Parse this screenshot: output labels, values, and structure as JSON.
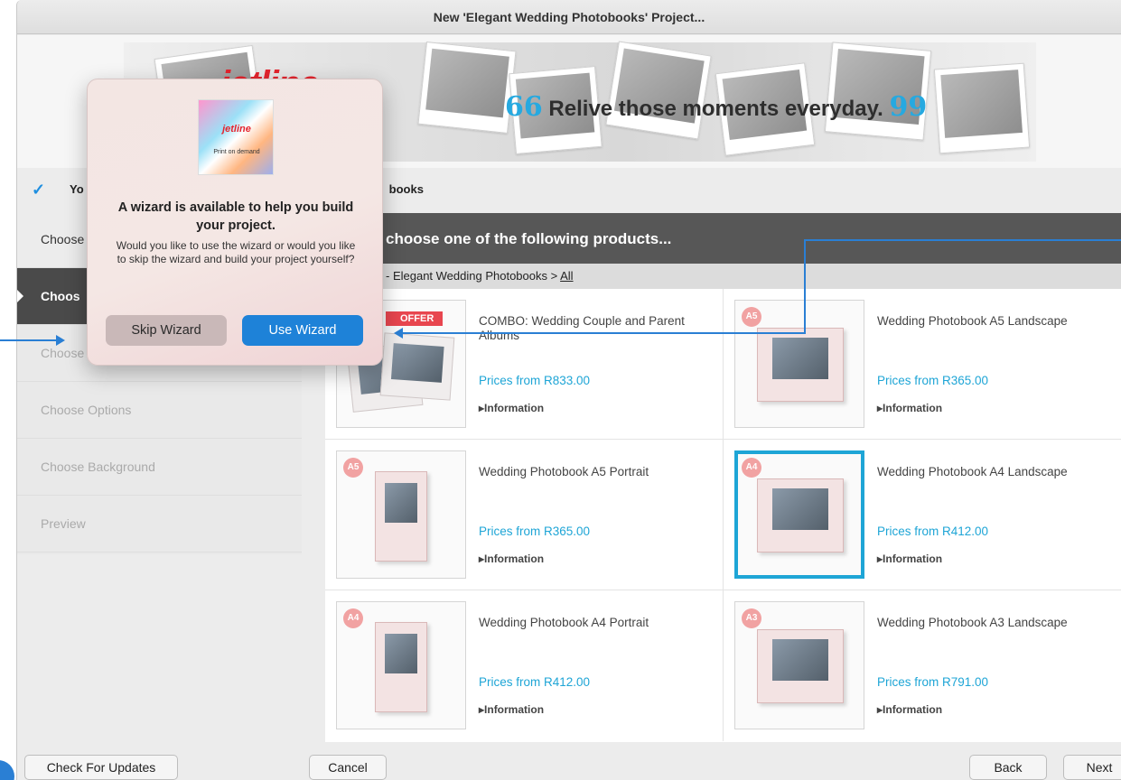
{
  "window": {
    "title": "New 'Elegant Wedding Photobooks' Project..."
  },
  "banner": {
    "logo_text": "jetline",
    "tagline": "Relive those moments everyday.",
    "quote_open": "66",
    "quote_close": "99"
  },
  "step": {
    "title_start": "Yo",
    "title_end": "books"
  },
  "sidebar": {
    "items": [
      {
        "label": "Choose"
      },
      {
        "label": "Choos"
      },
      {
        "label": "Choose"
      },
      {
        "label": "Choose Options"
      },
      {
        "label": "Choose Background"
      },
      {
        "label": "Preview"
      }
    ]
  },
  "main": {
    "header": "choose one of the following products...",
    "breadcrumb": {
      "prefix": "- Elegant Wedding Photobooks > ",
      "link": "All"
    }
  },
  "products": [
    {
      "name": "COMBO: Wedding Couple and Parent Albums",
      "price": "Prices from R833.00",
      "info": "▸Information",
      "badge": "",
      "ribbon": "OFFER"
    },
    {
      "name": "Wedding Photobook A5 Landscape",
      "price": "Prices from R365.00",
      "info": "▸Information",
      "badge": "A5"
    },
    {
      "name": "Wedding Photobook A5 Portrait",
      "price": "Prices from R365.00",
      "info": "▸Information",
      "badge": "A5"
    },
    {
      "name": "Wedding Photobook A4 Landscape",
      "price": "Prices from R412.00",
      "info": "▸Information",
      "badge": "A4"
    },
    {
      "name": "Wedding Photobook A4 Portrait",
      "price": "Prices from R412.00",
      "info": "▸Information",
      "badge": "A4"
    },
    {
      "name": "Wedding Photobook A3 Landscape",
      "price": "Prices from R791.00",
      "info": "▸Information",
      "badge": "A3"
    }
  ],
  "footer": {
    "check_updates": "Check For Updates",
    "cancel": "Cancel",
    "back": "Back",
    "next": "Next"
  },
  "dialog": {
    "logo_text": "jetline",
    "logo_sub": "Print on demand",
    "title": "A wizard is available to help you build your project.",
    "message": "Would you like to use the wizard or would you like to skip the wizard and build your project yourself?",
    "skip_label": "Skip Wizard",
    "use_label": "Use Wizard"
  },
  "colors": {
    "accent": "#1ea5d6",
    "primary_button": "#1e82d8",
    "header_bg": "#575757",
    "offer": "#e8464f"
  }
}
